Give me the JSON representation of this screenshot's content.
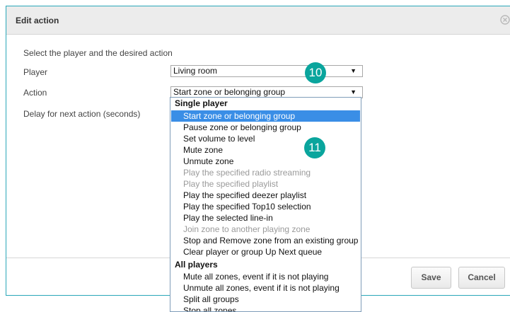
{
  "dialog": {
    "title": "Edit action",
    "instruction": "Select the player and the desired action",
    "player_label": "Player",
    "player_value": "Living room",
    "action_label": "Action",
    "action_value": "Start zone or belonging group",
    "delay_label": "Delay for next action (seconds)",
    "save_label": "Save",
    "cancel_label": "Cancel",
    "callout_player": "10",
    "callout_dropdown": "11"
  },
  "dropdown": {
    "group1": "Single player",
    "group1_options": [
      {
        "label": "Start zone or belonging group",
        "state": "selected"
      },
      {
        "label": "Pause zone or belonging group",
        "state": "normal"
      },
      {
        "label": "Set volume to level",
        "state": "normal"
      },
      {
        "label": "Mute zone",
        "state": "normal"
      },
      {
        "label": "Unmute zone",
        "state": "normal"
      },
      {
        "label": "Play the specified radio streaming",
        "state": "disabled"
      },
      {
        "label": "Play the specified playlist",
        "state": "disabled"
      },
      {
        "label": "Play the specified deezer playlist",
        "state": "normal"
      },
      {
        "label": "Play the specified Top10 selection",
        "state": "normal"
      },
      {
        "label": "Play the selected line-in",
        "state": "normal"
      },
      {
        "label": "Join zone to another playing zone",
        "state": "disabled"
      },
      {
        "label": "Stop and Remove zone from an existing group",
        "state": "normal"
      },
      {
        "label": "Clear player or group Up Next queue",
        "state": "normal"
      }
    ],
    "group2": "All players",
    "group2_options": [
      {
        "label": "Mute all zones, event if it is not playing",
        "state": "normal"
      },
      {
        "label": "Unmute all zones, event if it is not playing",
        "state": "normal"
      },
      {
        "label": "Split all groups",
        "state": "normal"
      },
      {
        "label": "Stop all zones",
        "state": "normal"
      }
    ]
  },
  "colors": {
    "accent": "#2aa7b8",
    "callout": "#0aa59d",
    "selected": "#3a8ee6"
  }
}
